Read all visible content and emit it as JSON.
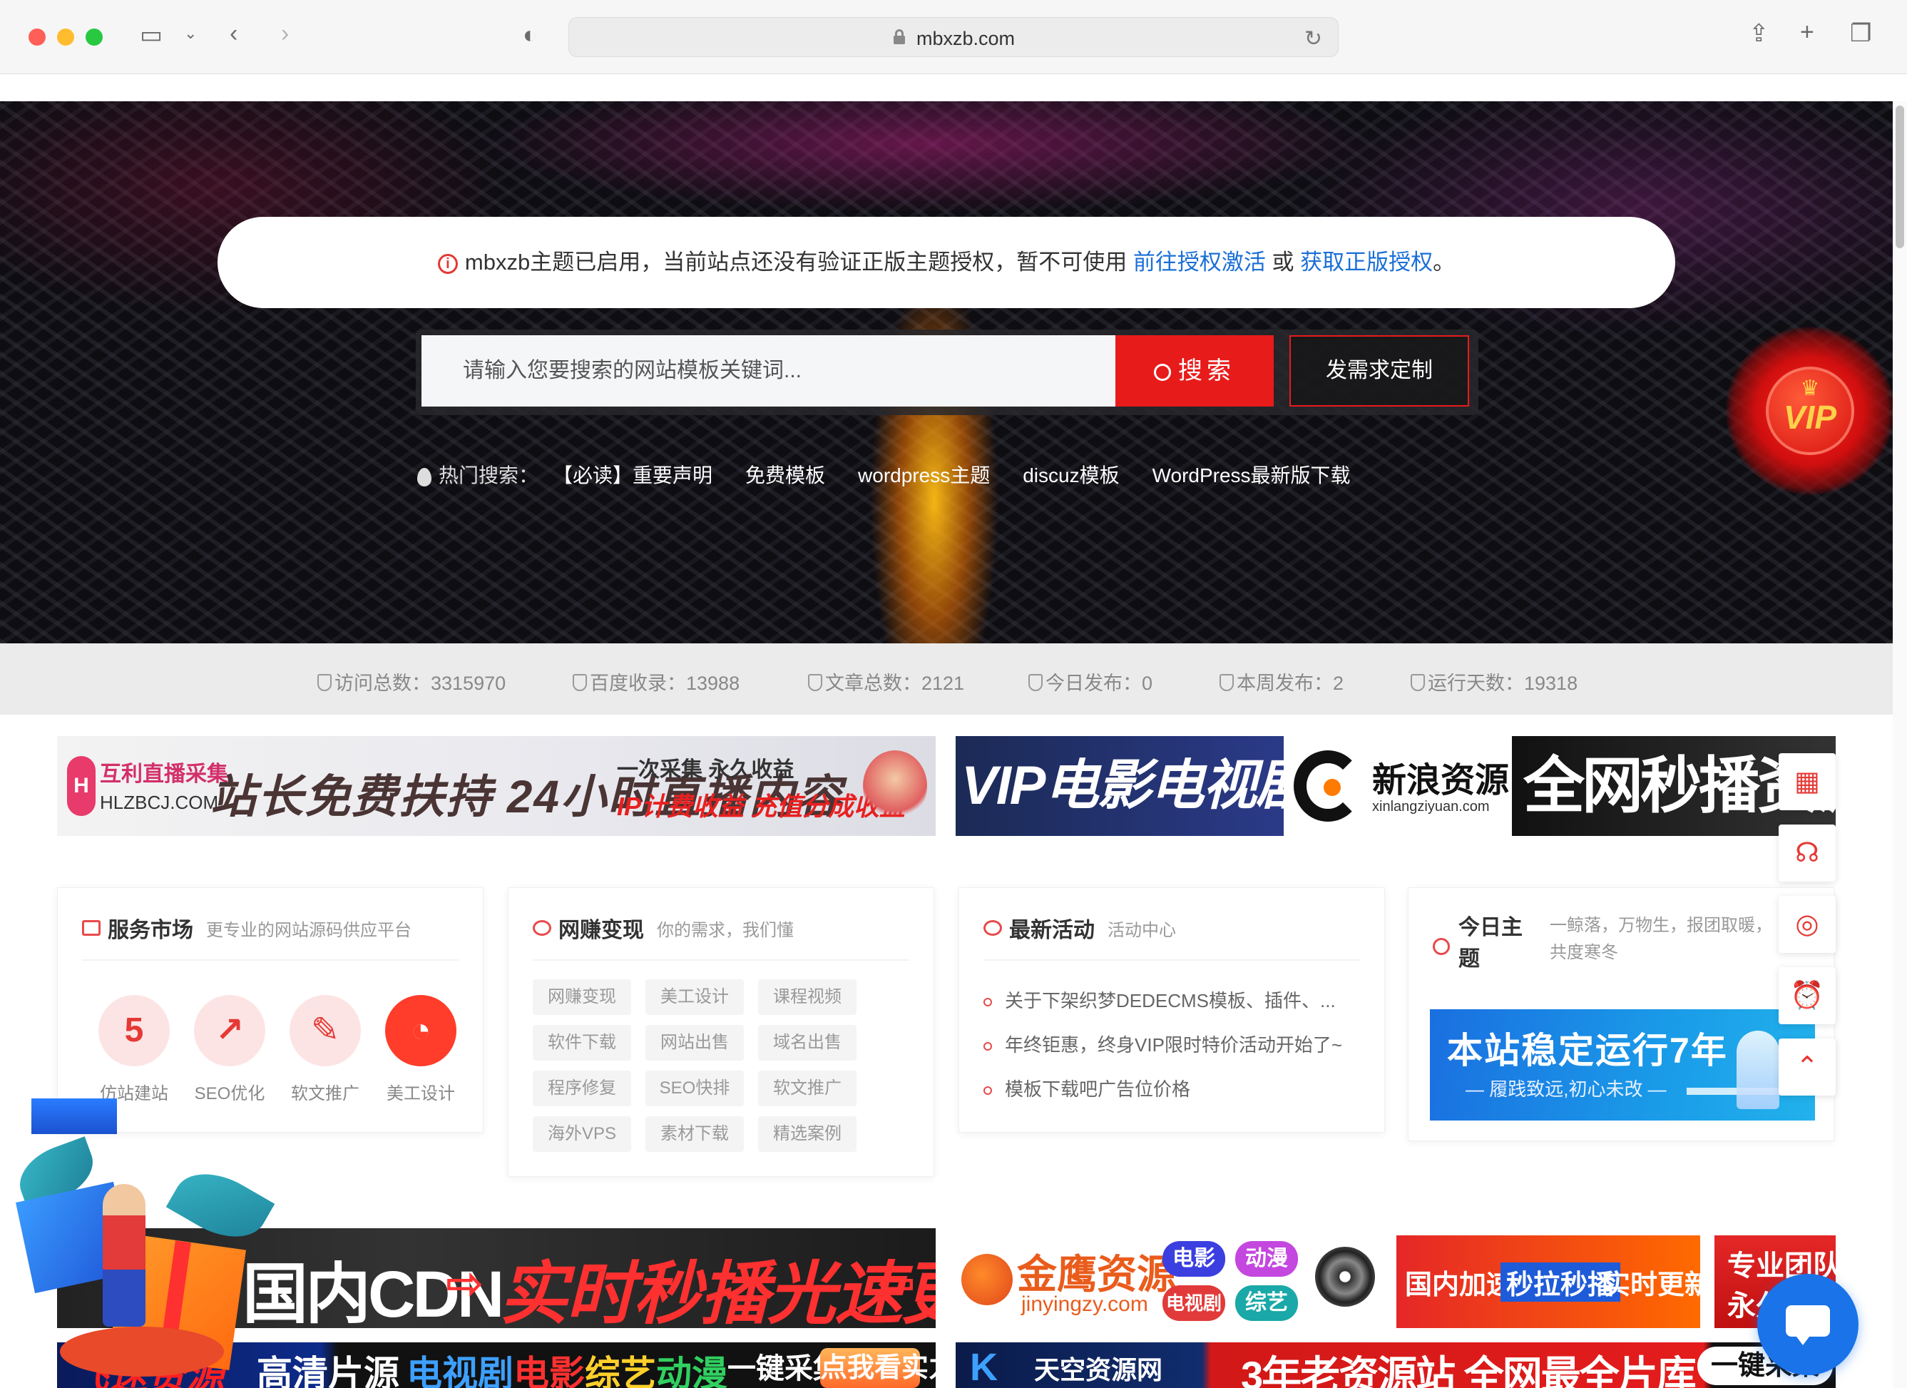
{
  "browser": {
    "url": "mbxzb.com"
  },
  "notice": {
    "text": "mbxzb主题已启用，当前站点还没有验证正版主题授权，暂不可使用",
    "link1": "前往授权激活",
    "or": " 或 ",
    "link2": "获取正版授权",
    "end": "。"
  },
  "search": {
    "placeholder": "请输入您要搜索的网站模板关键词...",
    "button": "搜索",
    "custom_button": "发需求定制"
  },
  "hot_search": {
    "label": "热门搜索：",
    "tags": [
      "【必读】重要声明",
      "免费模板",
      "wordpress主题",
      "discuz模板",
      "WordPress最新版下载"
    ]
  },
  "vip_badge": {
    "text": "VIP"
  },
  "stats": [
    {
      "label": "访问总数：",
      "value": "3315970"
    },
    {
      "label": "百度收录：",
      "value": "13988"
    },
    {
      "label": "文章总数：",
      "value": "2121"
    },
    {
      "label": "今日发布：",
      "value": "0"
    },
    {
      "label": "本周发布：",
      "value": "2"
    },
    {
      "label": "运行天数：",
      "value": "19318"
    }
  ],
  "ads_top": {
    "hlz": {
      "logo": "H",
      "brand": "互利直播采集",
      "site": "HLZBCJ.COM",
      "headline": "站长免费扶持 24小时直播内容",
      "line1": "一次采集 永久收益",
      "line2": "IP计费收益 充值分成收益"
    },
    "vip": {
      "part1": "VIP电影电视剧欧美剧",
      "brand": "新浪资源",
      "site": "xinlangziyuan.com",
      "part3": "全网秒播资源丰富"
    }
  },
  "cards": {
    "service": {
      "title": "服务市场",
      "subtitle": "更专业的网站源码供应平台",
      "items": [
        {
          "label": "仿站建站",
          "glyph": "5"
        },
        {
          "label": "SEO优化",
          "glyph": "↗"
        },
        {
          "label": "软文推广",
          "glyph": "✎"
        },
        {
          "label": "美工设计",
          "glyph": "◔"
        }
      ]
    },
    "earn": {
      "title": "网赚变现",
      "subtitle": "你的需求，我们懂",
      "tags": [
        "网赚变现",
        "美工设计",
        "课程视频",
        "软件下载",
        "网站出售",
        "域名出售",
        "程序修复",
        "SEO快排",
        "软文推广",
        "海外VPS",
        "素材下载",
        "精选案例"
      ]
    },
    "activity": {
      "title": "最新活动",
      "subtitle": "活动中心",
      "items": [
        "关于下架织梦DEDECMS模板、插件、...",
        "年终钜惠，终身VIP限时特价活动开始了~",
        "模板下载吧广告位价格"
      ]
    },
    "today": {
      "title": "今日主题",
      "subtitle": "一鲸落，万物生，报团取暖，共度寒冬",
      "promo_title": "本站稳定运行7年",
      "promo_sub": "— 履践致远,初心未改 —"
    }
  },
  "side_buttons": [
    "calendar-icon",
    "headset-icon",
    "wechat-icon",
    "alarm-icon",
    "top-icon"
  ],
  "ads_bottom": {
    "cdn": {
      "part1": "国内CDN",
      "part2": "实时秒播光速更新",
      "arrow_l": "⇨",
      "arrow_r": "⇦"
    },
    "jy": {
      "brand": "金鹰资源",
      "site": "jinyingzy.com",
      "pills": [
        "电影",
        "动漫",
        "电视剧",
        "综艺"
      ],
      "red": [
        "国内加速",
        "秒拉秒播",
        "实时更新"
      ],
      "team": [
        "专业团队",
        "永久免费"
      ]
    },
    "fs": {
      "brand": "飞速资源",
      "text": "高清片源",
      "tags": [
        "电视剧",
        "电影",
        "综艺",
        "动漫",
        "一键采集"
      ],
      "button": "点我看实力"
    },
    "tk": {
      "k": "K",
      "brand": "天空资源网",
      "main": "3年老资源站 全网最全片库",
      "right": "一键采集"
    }
  },
  "colors": {
    "accent": "#e81b1b",
    "link": "#1a6fd6",
    "chat": "#1a73e8"
  }
}
